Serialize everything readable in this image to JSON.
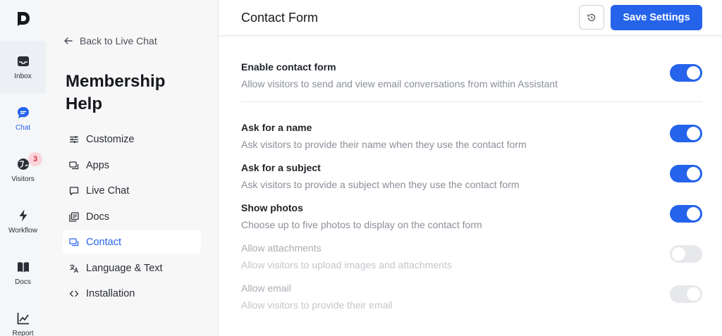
{
  "rail": {
    "logo": "D",
    "items": [
      {
        "label": "Inbox",
        "icon": "inbox-icon"
      },
      {
        "label": "Chat",
        "icon": "chat-icon"
      },
      {
        "label": "Visitors",
        "icon": "globe-icon",
        "badge": "3"
      },
      {
        "label": "Workflow",
        "icon": "bolt-icon"
      },
      {
        "label": "Docs",
        "icon": "book-icon"
      },
      {
        "label": "Report",
        "icon": "chart-icon"
      }
    ]
  },
  "sidebar": {
    "back_label": "Back to Live Chat",
    "title": "Membership Help",
    "items": [
      {
        "label": "Customize",
        "icon": "sliders-icon"
      },
      {
        "label": "Apps",
        "icon": "apps-icon"
      },
      {
        "label": "Live Chat",
        "icon": "message-icon"
      },
      {
        "label": "Docs",
        "icon": "docs-icon"
      },
      {
        "label": "Contact",
        "icon": "contact-icon",
        "active": true
      },
      {
        "label": "Language & Text",
        "icon": "translate-icon"
      },
      {
        "label": "Installation",
        "icon": "code-icon"
      }
    ]
  },
  "header": {
    "title": "Contact Form",
    "save_label": "Save Settings"
  },
  "settings": [
    {
      "title": "Enable contact form",
      "desc": "Allow visitors to send and view email conversations from within Assistant",
      "state": "on"
    },
    {
      "title": "Ask for a name",
      "desc": "Ask visitors to provide their name when they use the contact form",
      "state": "on"
    },
    {
      "title": "Ask for a subject",
      "desc": "Ask visitors to provide a subject when they use the contact form",
      "state": "on"
    },
    {
      "title": "Show photos",
      "desc": "Choose up to five photos to display on the contact form",
      "state": "on"
    },
    {
      "title": "Allow attachments",
      "desc": "Allow visitors to upload images and attachments",
      "state": "off-disabled"
    },
    {
      "title": "Allow email",
      "desc": "Allow visitors to provide their email",
      "state": "on-disabled"
    }
  ],
  "colors": {
    "accent": "#2563eb",
    "badge_bg": "#fbd5d9",
    "badge_text": "#d63649"
  }
}
